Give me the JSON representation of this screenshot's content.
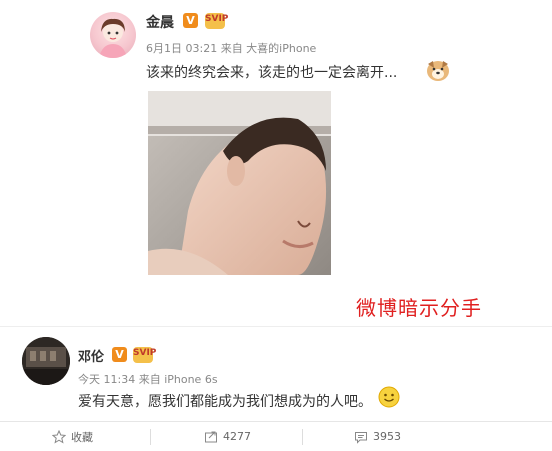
{
  "post1": {
    "username": "金晨",
    "verified_badge": "V",
    "vip_label": "SVIP",
    "meta": "6月1日 03:21 来自 大喜的iPhone",
    "content": "该来的终究会来，该走的也一定会离开..."
  },
  "watermark_text": "微博暗示分手",
  "post2": {
    "username": "邓伦",
    "verified_badge": "V",
    "vip_label": "SVIP",
    "meta": "今天 11:34 来自 iPhone 6s",
    "content": "爱有天意，愿我们都能成为我们想成为的人吧。"
  },
  "actions": {
    "collect_label": "收藏",
    "repost_count": "4277",
    "comment_count": "3953"
  },
  "colors": {
    "verified_orange": "#f08c1c",
    "watermark_red": "#e02020",
    "meta_gray": "#888888"
  },
  "icons": [
    "star-icon",
    "repost-icon",
    "comment-icon",
    "dog-emoji-icon",
    "smile-emoji-icon"
  ]
}
